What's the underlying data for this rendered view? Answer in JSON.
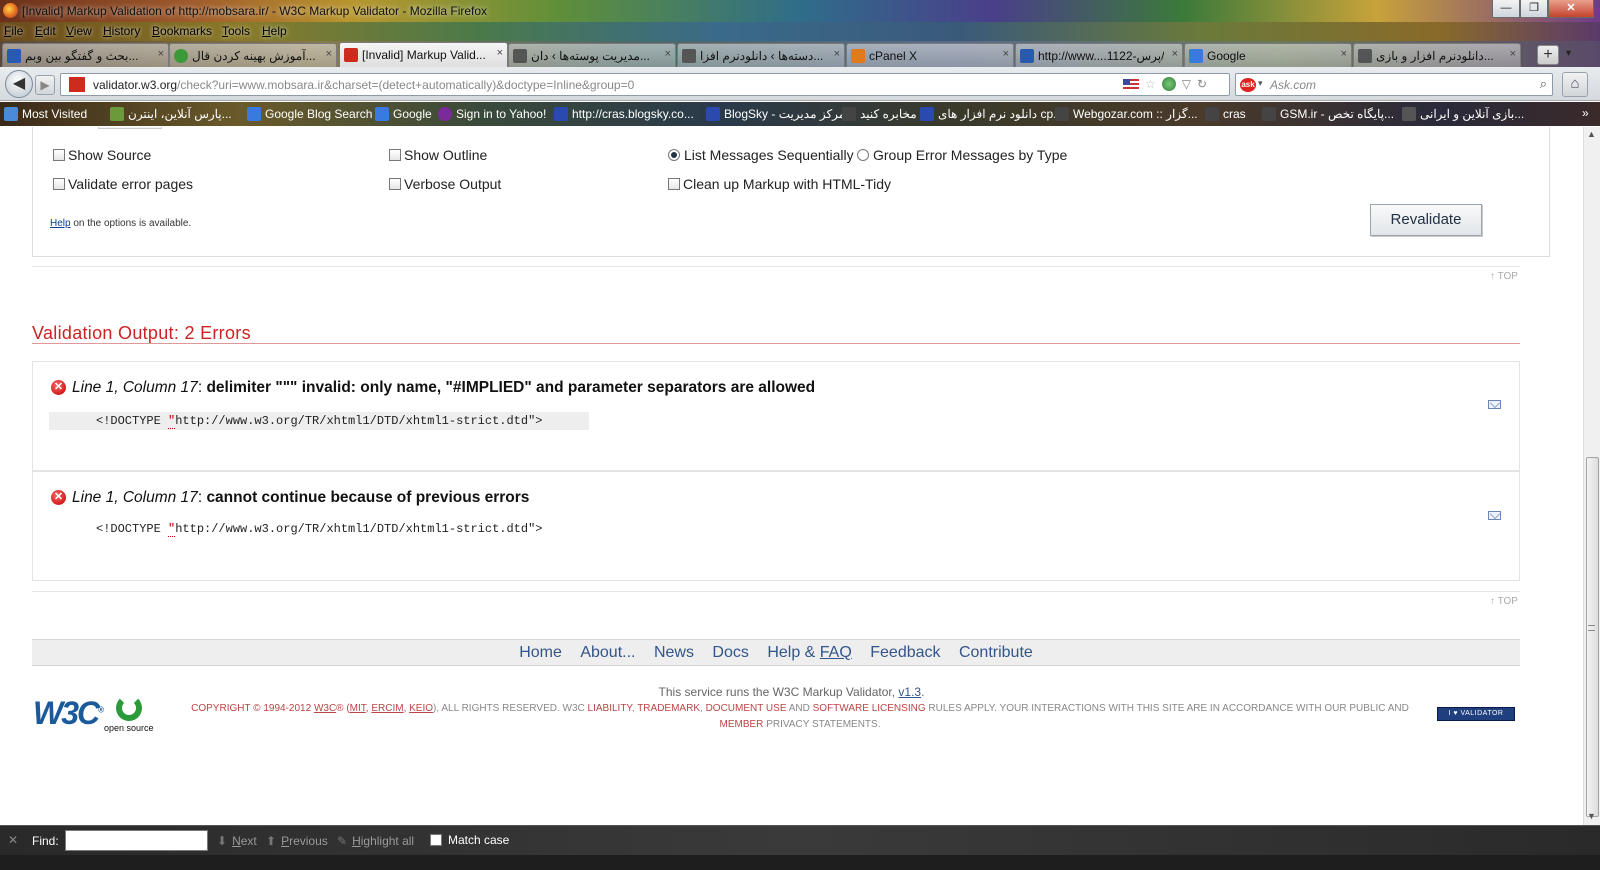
{
  "window": {
    "title": "[Invalid] Markup Validation of http://mobsara.ir/ - W3C Markup Validator - Mozilla Firefox",
    "minimize": "—",
    "maximize": "❐",
    "close": "✕"
  },
  "menu": [
    "File",
    "Edit",
    "View",
    "History",
    "Bookmarks",
    "Tools",
    "Help"
  ],
  "tabs": [
    {
      "label": "بحث و گفتگو بین وبم...",
      "icon_color": "#2a5ab0"
    },
    {
      "label": "آموزش بهینه کردن قال...",
      "icon_color": "#3a9a3a"
    },
    {
      "label": "[Invalid] Markup Valid...",
      "icon_color": "#cc2b1e"
    },
    {
      "label": "مدیریت پوسته‌ها › دان...",
      "icon_color": "#555555"
    },
    {
      "label": "دسته‌ها › دانلودنرم افزا...",
      "icon_color": "#555555"
    },
    {
      "label": "cPanel X",
      "icon_color": "#e07a1a"
    },
    {
      "label": "http://www....1122-پرس/",
      "icon_color": "#2a5ab0"
    },
    {
      "label": "Google",
      "icon_color": "#3a7ae0"
    },
    {
      "label": "دانلودنرم افزار و بازی...",
      "icon_color": "#555555"
    }
  ],
  "tab_close": "×",
  "newtab": "+",
  "tabmenu": "▾",
  "nav": {
    "back": "◀",
    "forward": "▶",
    "url_domain": "validator.w3.org",
    "url_rest": "/check?uri=www.mobsara.ir&charset=(detect+automatically)&doctype=Inline&group=0",
    "url_icons": {
      "star": "☆",
      "dropdown": "▽",
      "reload": "↻"
    },
    "search_engine": "ask",
    "search_placeholder": "Ask.com",
    "search_icon": "⌕",
    "home": "⌂"
  },
  "bookmarks": [
    {
      "label": "Most Visited",
      "icon_color": "#4a8ad6"
    },
    {
      "label": "پارس آنلاین، اینترن...",
      "icon_color": "#6a9a3a"
    },
    {
      "label": "Google Blog Search",
      "icon_color": "#3a7ae0"
    },
    {
      "label": "Google",
      "icon_color": "#3a7ae0"
    },
    {
      "label": "Sign in to Yahoo!",
      "icon_color": "#7a2a9a"
    },
    {
      "label": "http://cras.blogsky.co...",
      "icon_color": "#2a4ab0"
    },
    {
      "label": "BlogSky - مرکز مدیریت",
      "icon_color": "#2a4ab0"
    },
    {
      "label": "مخابره کنید",
      "icon_color": "#444444"
    },
    {
      "label": "دانلود نرم افزار های cp...",
      "icon_color": "#2a4ab0"
    },
    {
      "label": "Webgozar.com :: گزار...",
      "icon_color": "#444444"
    },
    {
      "label": "cras",
      "icon_color": "#444444"
    },
    {
      "label": "GSM.ir - پایگاه تخص...",
      "icon_color": "#444444"
    },
    {
      "label": "بازی آنلاین و ایرانی...",
      "icon_color": "#555555"
    }
  ],
  "bookmarks_more": "»",
  "options": {
    "show_source": "Show Source",
    "show_outline": "Show Outline",
    "list_sequential": "List Messages Sequentially",
    "group_by_type": "Group Error Messages by Type",
    "validate_error_pages": "Validate error pages",
    "verbose_output": "Verbose Output",
    "cleanup_tidy": "Clean up Markup with HTML-Tidy",
    "help_link": "Help",
    "help_rest": " on the options is available.",
    "revalidate": "Revalidate"
  },
  "top_link": "↑ TOP",
  "validation_title": "Validation Output: 2 Errors",
  "errors": [
    {
      "location": "Line 1, Column 17",
      "message": "delimiter \"\"\" invalid: only name, \"#IMPLIED\" and parameter separators are allowed",
      "src_before": "<!DOCTYPE ",
      "src_mark": "\"",
      "src_after": "http://www.w3.org/TR/xhtml1/DTD/xhtml1-strict.dtd\">"
    },
    {
      "location": "Line 1, Column 17",
      "message": "cannot continue because of previous errors",
      "src_before": "<!DOCTYPE ",
      "src_mark": "\"",
      "src_after": "http://www.w3.org/TR/xhtml1/DTD/xhtml1-strict.dtd\">"
    }
  ],
  "error_glyph": "✕",
  "footer": {
    "links": [
      "Home",
      "About...",
      "News",
      "Docs",
      "Help & ",
      "FAQ",
      "Feedback",
      "Contribute"
    ],
    "service_text": "This service runs the W3C Markup Validator, ",
    "service_version": "v1.3",
    "service_end": ".",
    "copyright": {
      "p1": "Copyright © 1994-2012 ",
      "w3c": "W3C",
      "p2": "® (",
      "mit": "MIT",
      "c1": ", ",
      "ercim": "ERCIM",
      "c2": ", ",
      "keio": "Keio",
      "p3": "), All Rights Reserved. W3C ",
      "liability": "liability",
      "c3": ", ",
      "trademark": "trademark",
      "c4": ", ",
      "docuse": "document use",
      "p4": " and ",
      "software": "software licensing",
      "p5": " rules apply. Your interactions with this site are in accordance with our ",
      "public": "public",
      "p6": " and ",
      "member": "Member",
      "p7": " privacy statements."
    },
    "w3c_logo": "W3C",
    "w3c_reg": "®",
    "os_logo": "open source",
    "badge": "I ♥ VALIDATOR"
  },
  "findbar": {
    "close": "✕",
    "label": "Find:",
    "next": "Next",
    "previous": "Previous",
    "highlight": "Highlight all",
    "match_case": "Match case",
    "next_icon": "⬇",
    "prev_icon": "⬆",
    "hl_icon": "✎"
  },
  "scroll": {
    "up": "▲",
    "down": "▼"
  }
}
